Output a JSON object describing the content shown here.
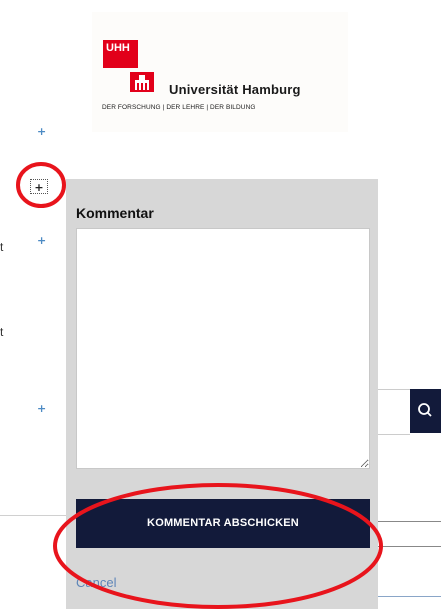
{
  "logo": {
    "mark": "UHH",
    "name": "Universität Hamburg",
    "tagline": "DER FORSCHUNG | DER LEHRE | DER BILDUNG",
    "brand_color": "#e2001a"
  },
  "page": {
    "plus_glyph": "+",
    "fragments": [
      "t",
      "t"
    ]
  },
  "comment_panel": {
    "title": "Kommentar",
    "textarea_value": "",
    "submit_label": "KOMMENTAR ABSCHICKEN",
    "cancel_label": "Cancel"
  },
  "colors": {
    "panel_bg": "#d7d7d7",
    "button_navy": "#121a3a",
    "link_blue": "#5f86b8",
    "highlight_red": "#e8141c"
  },
  "icons": {
    "search": "search-icon",
    "resize": "resize-grip-icon"
  }
}
